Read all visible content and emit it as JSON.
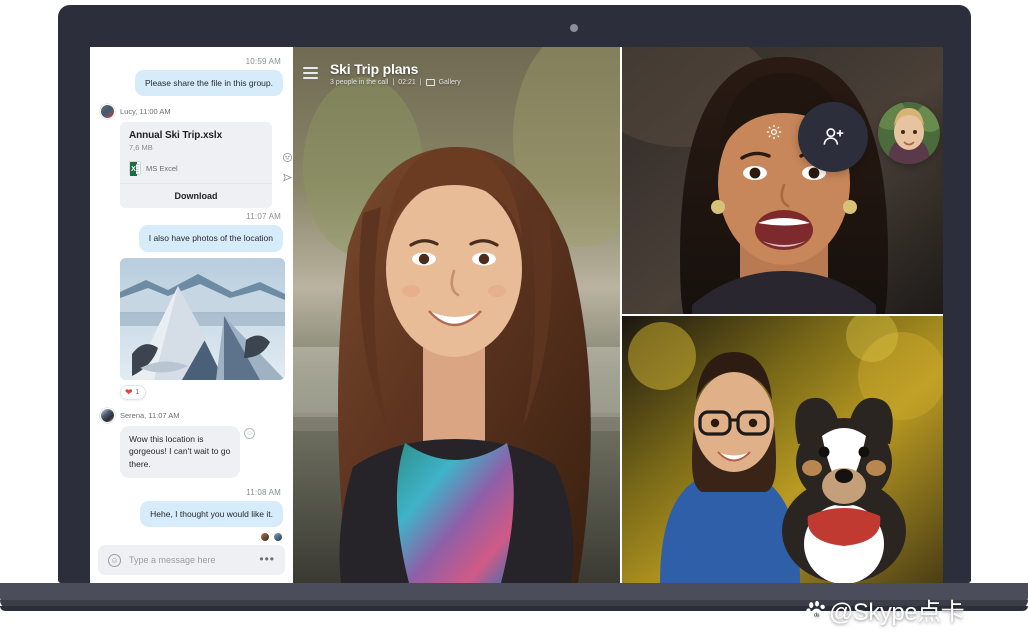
{
  "app": {
    "name": "Skype",
    "watermark": "@Skype点卡",
    "watermark_icon": "baidu-paw-icon"
  },
  "chat": {
    "messages": [
      {
        "type": "timestamp",
        "text": "10:59 AM"
      },
      {
        "type": "outgoing",
        "text": "Please share the file in this group."
      },
      {
        "type": "sender",
        "name": "Lucy, 11:00 AM"
      },
      {
        "type": "file",
        "title": "Annual Ski Trip.xslx",
        "size": "7,6 MB",
        "file_type": "MS Excel",
        "action": "Download"
      },
      {
        "type": "timestamp",
        "text": "11:07 AM"
      },
      {
        "type": "outgoing",
        "text": "I also have photos of the location"
      },
      {
        "type": "photo",
        "alt": "snowy-mountain-ridge-photo"
      },
      {
        "type": "reaction",
        "emoji": "❤",
        "count": "1"
      },
      {
        "type": "sender",
        "name": "Serena, 11:07 AM"
      },
      {
        "type": "incoming",
        "text": "Wow this location is gorgeous! I can't wait to go there."
      },
      {
        "type": "timestamp",
        "text": "11:08 AM"
      },
      {
        "type": "outgoing",
        "text": "Hehe, I thought you would like it."
      }
    ],
    "side_icons": [
      "emoji-reaction-icon",
      "forward-icon"
    ],
    "composer": {
      "placeholder": "Type a message here",
      "emoji_icon": "emoji-icon",
      "more_icon": "more-options-icon"
    }
  },
  "call": {
    "title": "Ski Trip plans",
    "participants_text": "3 people in the call",
    "duration": "02:21",
    "separator": "|",
    "layout_label": "Gallery",
    "menu_icon": "hamburger-menu-icon",
    "gallery_icon": "gallery-layout-icon",
    "settings_icon": "gear-icon",
    "add_people_icon": "add-person-icon",
    "controls": [
      {
        "name": "chat-button",
        "icon": "chat-bubble-icon"
      },
      {
        "name": "speaker-button",
        "icon": "speaker-icon"
      },
      {
        "name": "microphone-button",
        "icon": "microphone-icon"
      },
      {
        "name": "camera-button",
        "icon": "video-camera-icon"
      },
      {
        "name": "end-call-button",
        "icon": "phone-hangup-icon",
        "color": "#f1453d"
      }
    ],
    "secondary_controls": [
      {
        "name": "share-screen-button",
        "icon": "share-screen-icon"
      },
      {
        "name": "snapshot-button",
        "icon": "snapshot-icon"
      },
      {
        "name": "reaction-button",
        "icon": "heart-icon",
        "color": "#f1453d"
      },
      {
        "name": "add-more-button",
        "icon": "plus-icon"
      }
    ],
    "participants": [
      {
        "name": "main-speaker",
        "position": "left-large"
      },
      {
        "name": "participant-top-right",
        "position": "top-right"
      },
      {
        "name": "participant-bottom-right",
        "position": "bottom-right"
      },
      {
        "name": "participant-avatar-circle",
        "position": "header-circle"
      },
      {
        "name": "self-view-thumbnail",
        "position": "header-thumbnail"
      }
    ]
  },
  "device": {
    "type": "laptop",
    "webcam": "webcam-dot"
  }
}
